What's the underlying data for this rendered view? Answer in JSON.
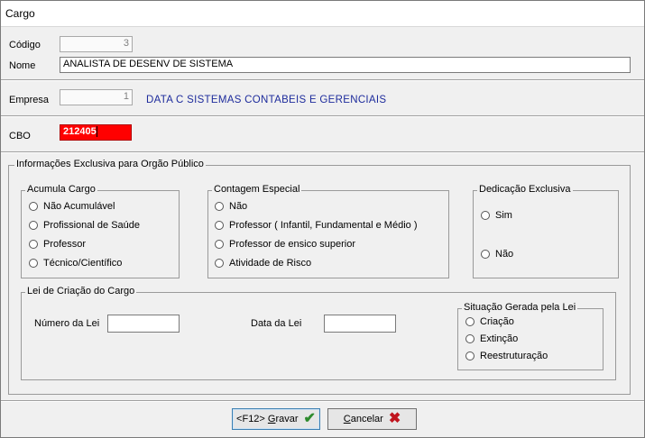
{
  "window": {
    "title": "Cargo"
  },
  "codigo": {
    "label": "Código",
    "value": "3"
  },
  "nome": {
    "label": "Nome",
    "value": "ANALISTA DE DESENV DE SISTEMA"
  },
  "empresa": {
    "label": "Empresa",
    "value": "1",
    "company_name": "DATA C SISTEMAS CONTABEIS E GERENCIAIS"
  },
  "cbo": {
    "label": "CBO",
    "value": "212405"
  },
  "info_group": {
    "title": "Informações Exclusiva para Orgão Público",
    "acumula_cargo": {
      "title": "Acumula Cargo",
      "options": [
        "Não Acumulável",
        "Profissional de Saúde",
        "Professor",
        "Técnico/Científico"
      ]
    },
    "contagem_especial": {
      "title": "Contagem Especial",
      "options": [
        "Não",
        "Professor ( Infantil, Fundamental e Médio )",
        "Professor de ensico superior",
        "Atividade de Risco"
      ]
    },
    "dedicacao_exclusiva": {
      "title": "Dedicação Exclusiva",
      "options": [
        "Sim",
        "Não"
      ]
    },
    "lei_criacao": {
      "title": "Lei de Criação do Cargo",
      "numero_label": "Número da Lei",
      "numero_value": "",
      "data_label": "Data da Lei",
      "data_value": "",
      "situacao": {
        "title": "Situação Gerada pela Lei",
        "options": [
          "Criação",
          "Extinção",
          "Reestruturação"
        ]
      }
    }
  },
  "buttons": {
    "gravar_prefix": "<F12> ",
    "gravar_accel": "G",
    "gravar_rest": "ravar",
    "cancelar_accel": "C",
    "cancelar_rest": "ancelar"
  },
  "colors": {
    "cbo_bg": "#ff0000",
    "company_text": "#1d2b9c",
    "check": "#2e8b2e",
    "x": "#c0141e"
  },
  "icons": {
    "gravar": "checkmark-icon",
    "cancelar": "x-icon"
  }
}
